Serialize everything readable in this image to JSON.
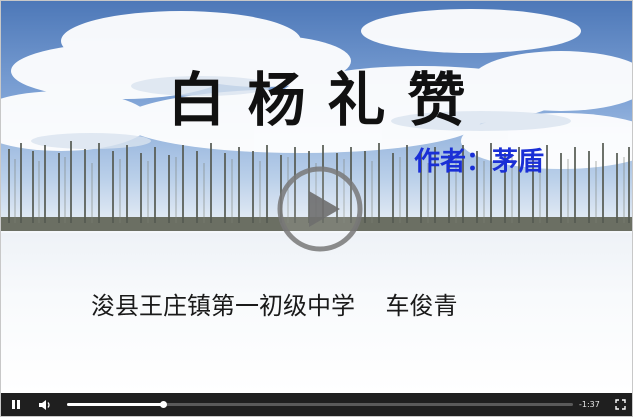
{
  "video": {
    "title": "白杨礼赞",
    "author_line": "作者：茅盾",
    "school_line": "浚县王庄镇第一初级中学    车俊青"
  },
  "controls": {
    "time_remaining": "-1:37",
    "progress_fraction": 0.19,
    "icons": [
      "pause-icon",
      "volume-icon",
      "fullscreen-icon",
      "play-icon"
    ]
  },
  "colors": {
    "title": "#111111",
    "author": "#1a2fd6",
    "control_bar": "#1f1f1f"
  }
}
